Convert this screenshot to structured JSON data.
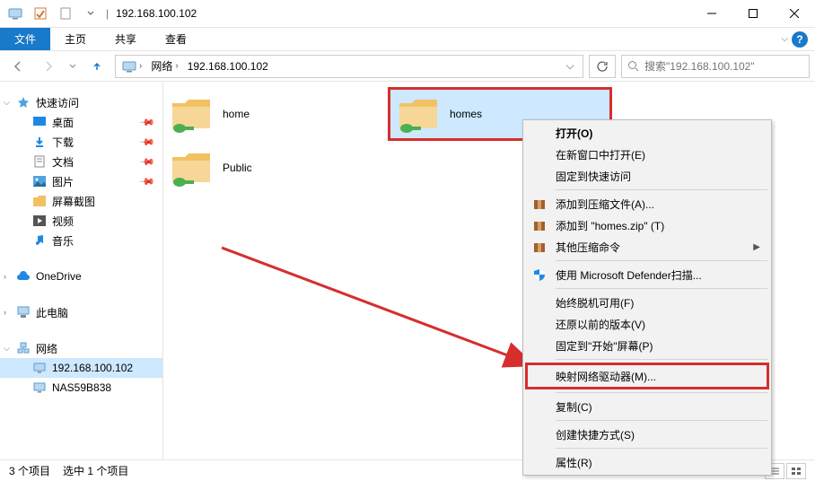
{
  "titlebar": {
    "title": "192.168.100.102",
    "separator": "|"
  },
  "tabs": {
    "file": "文件",
    "home": "主页",
    "share": "共享",
    "view": "查看"
  },
  "address": {
    "seg_network": "网络",
    "seg_host": "192.168.100.102"
  },
  "search": {
    "placeholder": "搜索\"192.168.100.102\""
  },
  "nav": {
    "quick_access": "快速访问",
    "desktop": "桌面",
    "downloads": "下载",
    "documents": "文档",
    "pictures": "图片",
    "screenshots": "屏幕截图",
    "videos": "视频",
    "music": "音乐",
    "onedrive": "OneDrive",
    "this_pc": "此电脑",
    "network": "网络",
    "host1": "192.168.100.102",
    "host2": "NAS59B838"
  },
  "folders": {
    "home": "home",
    "homes": "homes",
    "public": "Public"
  },
  "ctx": {
    "open": "打开(O)",
    "open_new": "在新窗口中打开(E)",
    "pin_quick": "固定到快速访问",
    "add_archive": "添加到压缩文件(A)...",
    "add_zip": "添加到 \"homes.zip\" (T)",
    "other_archive": "其他压缩命令",
    "defender": "使用 Microsoft Defender扫描...",
    "always_offline": "始终脱机可用(F)",
    "restore_prev": "还原以前的版本(V)",
    "pin_start": "固定到\"开始\"屏幕(P)",
    "map_drive": "映射网络驱动器(M)...",
    "copy": "复制(C)",
    "create_shortcut": "创建快捷方式(S)",
    "properties": "属性(R)"
  },
  "status": {
    "count": "3 个项目",
    "selected": "选中 1 个项目"
  },
  "colors": {
    "accent": "#1979ca",
    "highlight": "#d62e2e",
    "selection": "#cde8ff"
  }
}
